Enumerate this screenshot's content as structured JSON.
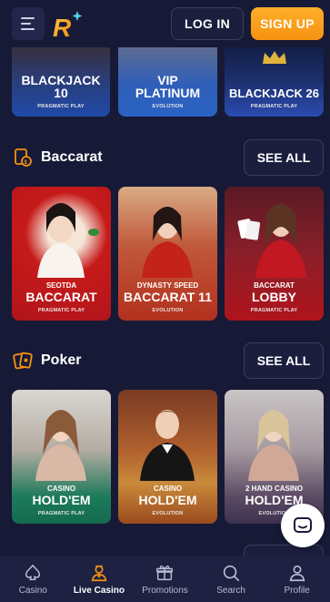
{
  "header": {
    "login_label": "LOG IN",
    "signup_label": "SIGN UP",
    "logo_letter": "R"
  },
  "top_row": [
    {
      "title": "BLACKJACK",
      "title2": "10",
      "provider": "PRAGMATIC PLAY"
    },
    {
      "title": "VIP",
      "title2": "PLATINUM",
      "provider": "EVOLUTION"
    },
    {
      "title": "BLACKJACK 26",
      "title2": "",
      "provider": "PRAGMATIC PLAY"
    }
  ],
  "sections": [
    {
      "title": "Baccarat",
      "see_all": "SEE ALL",
      "games": [
        {
          "sub": "SEOTDA",
          "title": "BACCARAT",
          "provider": "PRAGMATIC PLAY"
        },
        {
          "sub": "DYNASTY SPEED",
          "title": "BACCARAT 11",
          "provider": "EVOLUTION"
        },
        {
          "sub": "BACCARAT",
          "title": "LOBBY",
          "provider": "PRAGMATIC PLAY"
        }
      ]
    },
    {
      "title": "Poker",
      "see_all": "SEE ALL",
      "games": [
        {
          "sub": "CASINO",
          "title": "HOLD'EM",
          "provider": "PRAGMATIC PLAY"
        },
        {
          "sub": "CASINO",
          "title": "HOLD'EM",
          "provider": "EVOLUTION"
        },
        {
          "sub": "2 HAND CASINO",
          "title": "HOLD'EM",
          "provider": "EVOLUTION"
        }
      ]
    }
  ],
  "bottom_nav": [
    {
      "label": "Casino",
      "icon": "spade-icon"
    },
    {
      "label": "Live Casino",
      "icon": "dealer-icon",
      "active": true
    },
    {
      "label": "Promotions",
      "icon": "gift-icon"
    },
    {
      "label": "Search",
      "icon": "search-icon"
    },
    {
      "label": "Profile",
      "icon": "profile-icon"
    }
  ],
  "colors": {
    "background": "#171a36",
    "accent": "#f59110",
    "nav_bg": "#1e2142"
  }
}
